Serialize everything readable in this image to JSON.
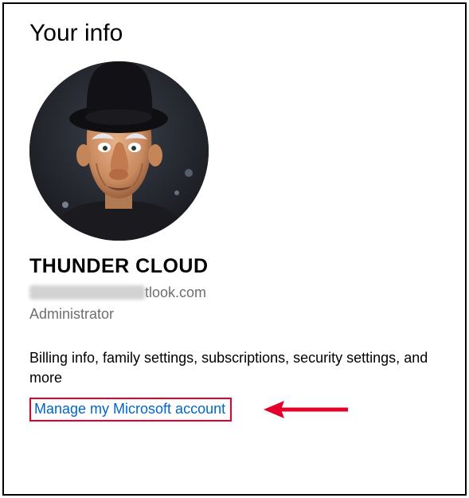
{
  "title": "Your info",
  "user": {
    "name": "THUNDER CLOUD",
    "email_visible_suffix": "tlook.com",
    "role": "Administrator"
  },
  "description": "Billing info, family settings, subscriptions, security settings, and more",
  "link": {
    "manage_label": "Manage my Microsoft account"
  },
  "annotation": {
    "highlight_color": "#e4002b",
    "arrow_color": "#e4002b"
  }
}
